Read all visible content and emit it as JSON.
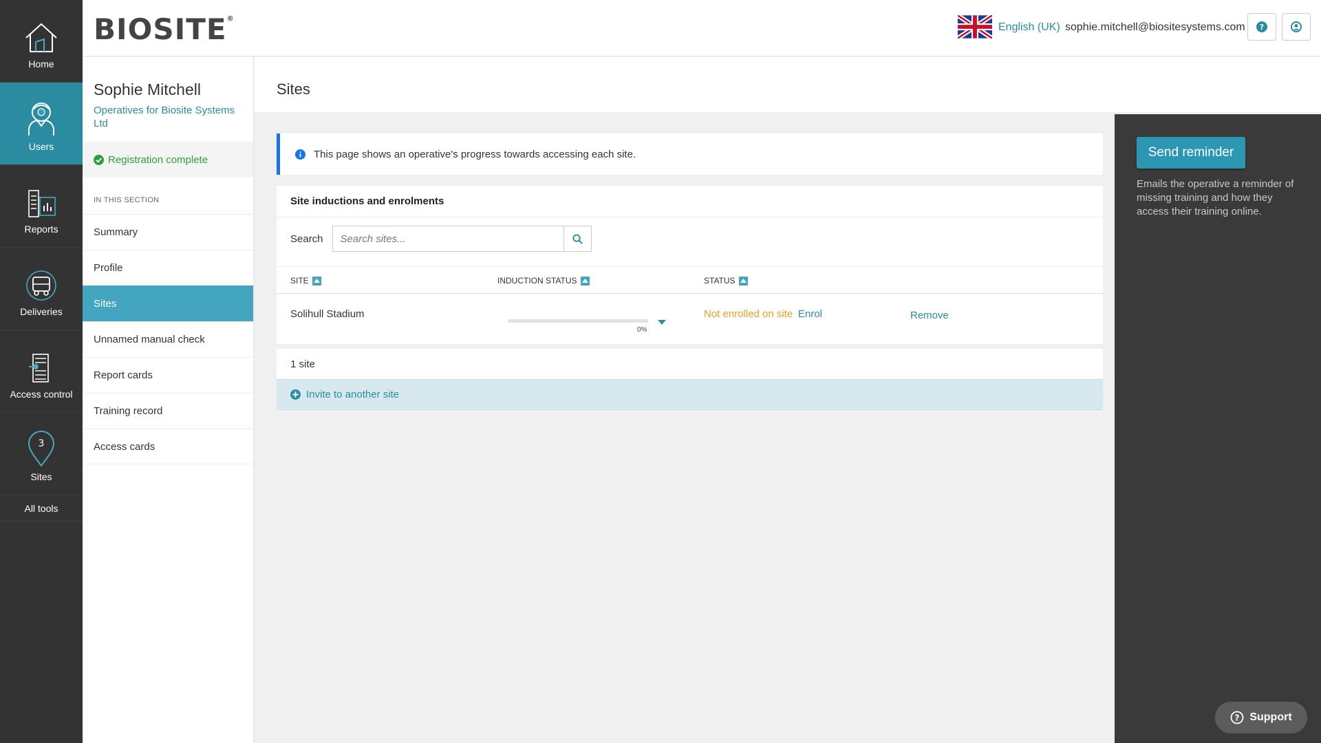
{
  "rail": {
    "items": [
      {
        "label": "Home",
        "icon": "home-icon",
        "active": false
      },
      {
        "label": "Users",
        "icon": "user-icon",
        "active": true
      },
      {
        "label": "Reports",
        "icon": "reports-icon",
        "active": false
      },
      {
        "label": "Deliveries",
        "icon": "truck-icon",
        "active": false
      },
      {
        "label": "Access control",
        "icon": "turnstile-icon",
        "active": false
      },
      {
        "label": "Sites",
        "icon": "map-pin-icon",
        "active": false
      }
    ],
    "sites_badge": "3",
    "all_tools": "All tools"
  },
  "header": {
    "logo": "BIOSITE",
    "logo_mark": "®",
    "language": "English (UK)",
    "email": "sophie.mitchell@biositesystems.com"
  },
  "sidebar": {
    "name": "Sophie Mitchell",
    "org": "Operatives for Biosite Systems Ltd",
    "registration": "Registration complete",
    "section_label": "IN THIS SECTION",
    "items": [
      {
        "label": "Summary"
      },
      {
        "label": "Profile"
      },
      {
        "label": "Sites"
      },
      {
        "label": "Unnamed manual check"
      },
      {
        "label": "Report cards"
      },
      {
        "label": "Training record"
      },
      {
        "label": "Access cards"
      }
    ]
  },
  "main": {
    "title": "Sites",
    "info": "This page shows an operative's progress towards accessing each site.",
    "card_title": "Site inductions and enrolments",
    "search_label": "Search",
    "search_placeholder": "Search sites...",
    "columns": [
      "SITE",
      "INDUCTION STATUS",
      "STATUS"
    ],
    "rows": [
      {
        "site": "Solihull Stadium",
        "induction_progress": 0,
        "induction_pct_label": "0%",
        "status": "Not enrolled on site",
        "enrol": "Enrol",
        "remove": "Remove"
      }
    ],
    "count": "1 site",
    "invite": "Invite to another site"
  },
  "right_panel": {
    "button": "Send reminder",
    "description": "Emails the operative a reminder of missing training and how they access their training online."
  },
  "support": "Support",
  "colors": {
    "rail_bg": "#333333",
    "accent": "#2b8ba1",
    "active_nav": "#43a5bf",
    "status_warning": "#f0a020",
    "success": "#2e9e3a"
  }
}
